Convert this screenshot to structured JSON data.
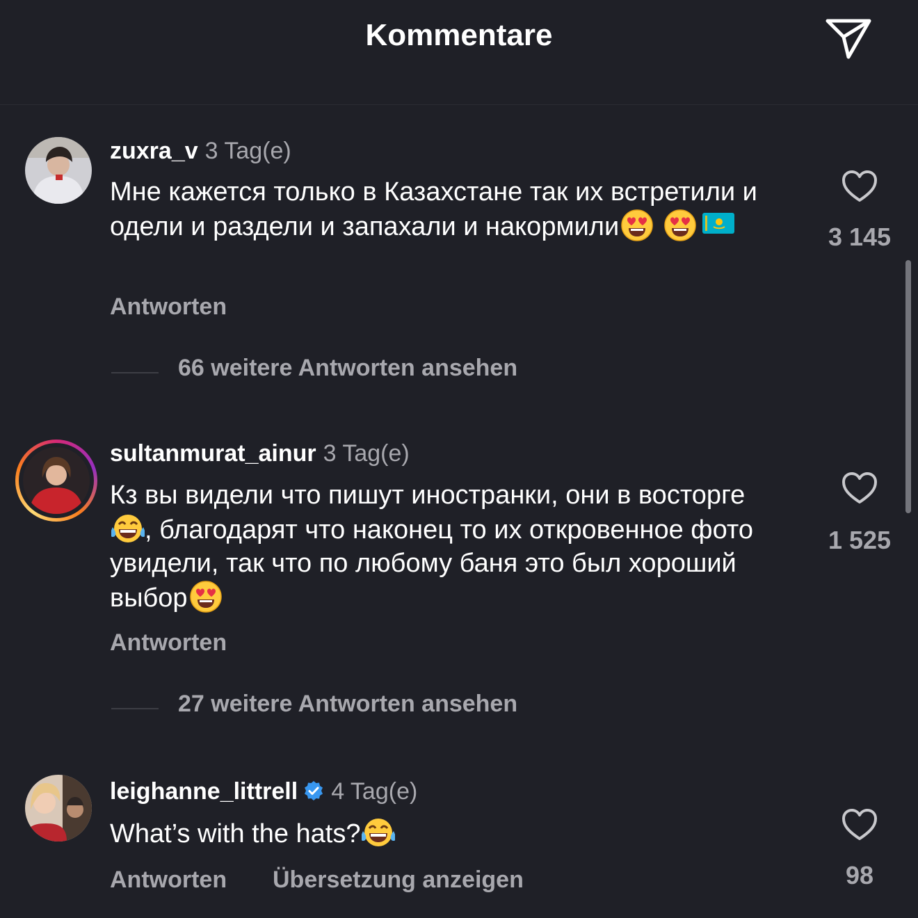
{
  "header": {
    "title": "Kommentare",
    "share_icon": "paper-plane-icon"
  },
  "comments": [
    {
      "username": "zuxra_v",
      "time": "3 Tag(e)",
      "text": "Мне кажется только в Казахстане так их встретили и одели и раздели и запахали и накормили",
      "emojis": [
        "heart-eyes-emoji",
        "heart-eyes-emoji",
        "kazakhstan-flag-emoji"
      ],
      "reply_label": "Antworten",
      "more_replies": "66 weitere Antworten ansehen",
      "likes": "3 145"
    },
    {
      "username": "sultanmurat_ainur",
      "time": "3 Tag(e)",
      "text_1": "Кз вы видели что пишут иностранки, они в восторге",
      "text_2": ", благодарят что наконец то их откровенное фото увидели, так что по любому баня это был хороший выбор",
      "emojis": [
        "tears-of-joy-emoji",
        "heart-eyes-emoji"
      ],
      "has_story_ring": true,
      "reply_label": "Antworten",
      "more_replies": "27 weitere Antworten ansehen",
      "likes": "1 525"
    },
    {
      "username": "leighanne_littrell",
      "verified": true,
      "time": "4 Tag(e)",
      "text": "What’s with the hats?",
      "emojis": [
        "tears-of-joy-emoji"
      ],
      "reply_label": "Antworten",
      "translate_label": "Übersetzung anzeigen",
      "likes": "98"
    }
  ],
  "colors": {
    "background": "#1f2027",
    "secondary_text": "#a8a8ae",
    "verified_badge": "#3897f0"
  }
}
